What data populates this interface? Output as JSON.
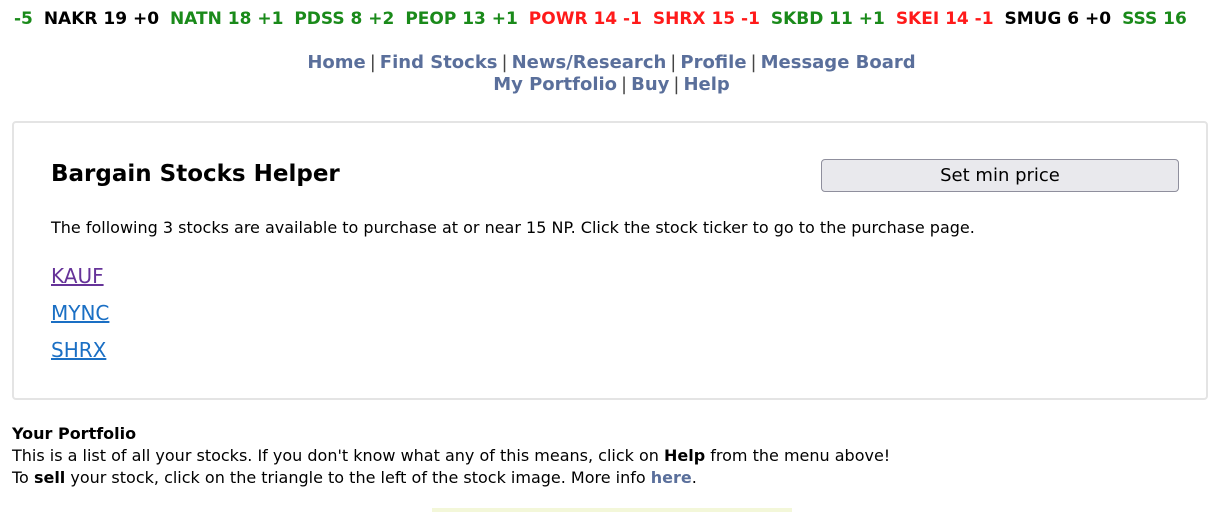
{
  "ticker": [
    {
      "text": "-5",
      "dir": "up"
    },
    {
      "text": "NAKR 19 +0",
      "dir": "flat"
    },
    {
      "text": "NATN 18 +1",
      "dir": "up"
    },
    {
      "text": "PDSS 8 +2",
      "dir": "up"
    },
    {
      "text": "PEOP 13 +1",
      "dir": "up"
    },
    {
      "text": "POWR 14 -1",
      "dir": "down"
    },
    {
      "text": "SHRX 15 -1",
      "dir": "down"
    },
    {
      "text": "SKBD 11 +1",
      "dir": "up"
    },
    {
      "text": "SKEI 14 -1",
      "dir": "down"
    },
    {
      "text": "SMUG 6 +0",
      "dir": "flat"
    },
    {
      "text": "SSS 16",
      "dir": "up"
    }
  ],
  "nav": {
    "home": "Home",
    "find_stocks": "Find Stocks",
    "news": "News/Research",
    "profile": "Profile",
    "message_board": "Message Board",
    "my_portfolio": "My Portfolio",
    "buy": "Buy",
    "help": "Help",
    "separator": "|"
  },
  "helper": {
    "title": "Bargain Stocks Helper",
    "button_label": "Set min price",
    "description": "The following 3 stocks are available to purchase at or near 15 NP. Click the stock ticker to go to the purchase page.",
    "stocks": [
      {
        "ticker": "KAUF",
        "visited": true
      },
      {
        "ticker": "MYNC",
        "visited": false
      },
      {
        "ticker": "SHRX",
        "visited": false
      }
    ]
  },
  "portfolio": {
    "heading": "Your Portfolio",
    "line1_prefix": "This is a list of all your stocks. If you don't know what any of this means, click on ",
    "line1_bold": "Help",
    "line1_suffix": " from the menu above!",
    "line2_prefix": "To ",
    "line2_bold": "sell",
    "line2_middle": " your stock, click on the triangle to the left of the stock image. More info ",
    "line2_link": "here",
    "line2_suffix": "."
  },
  "colors": {
    "up": "#1a8a1a",
    "down": "#ff1a1a",
    "nav_link": "#5a6f9b",
    "link": "#1a6fc4",
    "visited_link": "#663399"
  }
}
